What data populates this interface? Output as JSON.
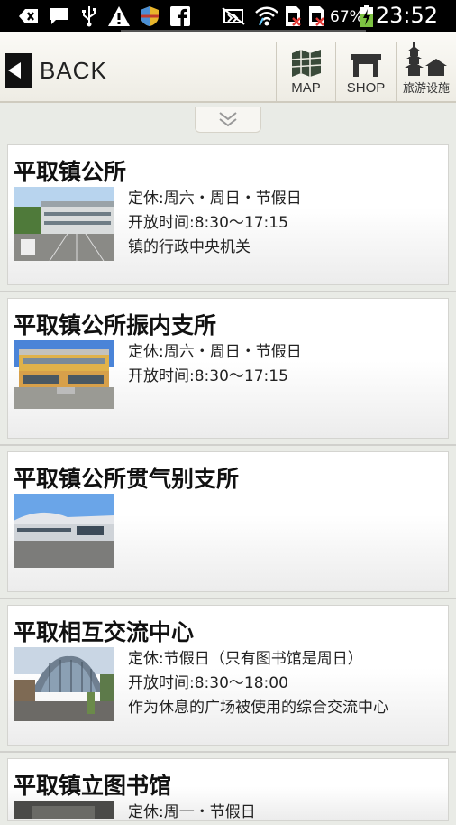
{
  "status_bar": {
    "battery_percent": "67%",
    "time": "23:52"
  },
  "topbar": {
    "back_label": "BACK",
    "nav": [
      {
        "label": "MAP",
        "icon": "map-icon"
      },
      {
        "label": "SHOP",
        "icon": "shop-icon"
      },
      {
        "label": "旅游设施",
        "icon": "tourism-facility-icon"
      }
    ]
  },
  "items": [
    {
      "title": "平取镇公所",
      "lines": [
        "定休:周六・周日・节假日",
        "开放时间:8:30～17:15",
        "镇的行政中央机关"
      ]
    },
    {
      "title": "平取镇公所振内支所",
      "lines": [
        "定休:周六・周日・节假日",
        "开放时间:8:30～17:15"
      ]
    },
    {
      "title": "平取镇公所贯气别支所",
      "lines": []
    },
    {
      "title": "平取相互交流中心",
      "lines": [
        "定休:节假日（只有图书馆是周日）",
        "开放时间:8:30～18:00",
        "作为休息的广场被使用的综合交流中心"
      ]
    },
    {
      "title": "平取镇立图书馆",
      "lines": [
        "定休:周一・节假日"
      ]
    }
  ]
}
